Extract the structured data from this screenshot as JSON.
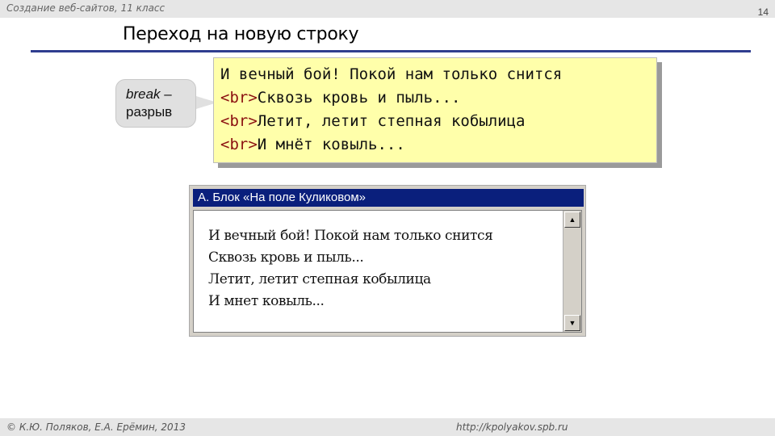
{
  "header": {
    "course": "Создание веб-сайтов, 11 класс",
    "page_number": "14"
  },
  "slide": {
    "title": "Переход на новую строку"
  },
  "callout": {
    "keyword": "break",
    "dash": " –",
    "translation": "разрыв"
  },
  "code": {
    "tag": "<br>",
    "lines": [
      {
        "text": "И вечный бой! Покой нам только снится"
      },
      {
        "text": "Сквозь кровь и пыль..."
      },
      {
        "text": "Летит, летит степная кобылица"
      },
      {
        "text": "И мнёт ковыль..."
      }
    ]
  },
  "browser": {
    "title": "А. Блок «На поле Куликовом»",
    "lines": [
      "И вечный бой! Покой нам только снится",
      "Сквозь кровь и пыль...",
      "Летит, летит степная кобылица",
      "И мнет ковыль..."
    ],
    "scroll_up_glyph": "▲",
    "scroll_down_glyph": "▼"
  },
  "footer": {
    "copyright": "© К.Ю. Поляков, Е.А. Ерёмин, 2013",
    "url": "http://kpolyakov.spb.ru"
  }
}
